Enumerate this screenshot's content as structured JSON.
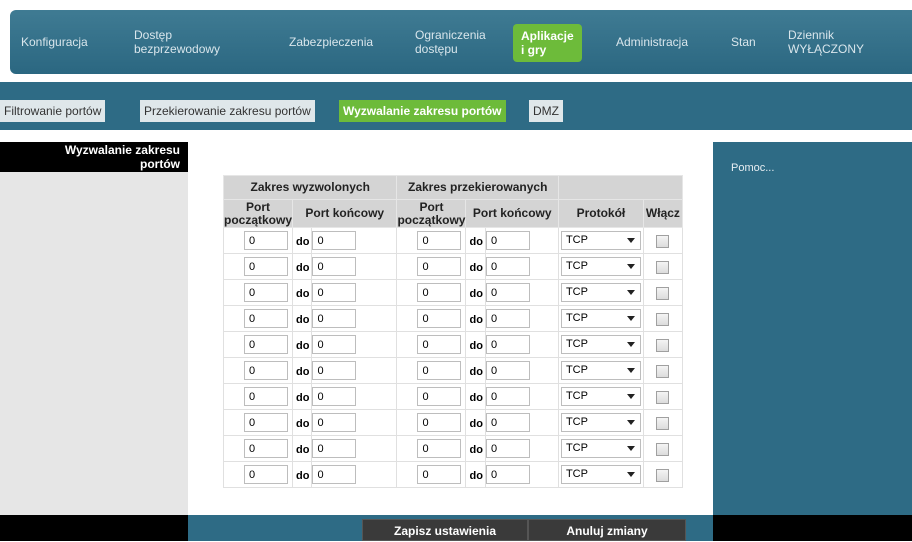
{
  "nav": {
    "items": [
      {
        "label": "Konfiguracja"
      },
      {
        "label1": "Dostęp",
        "label2": "bezprzewodowy"
      },
      {
        "label": "Zabezpieczenia"
      },
      {
        "label1": "Ograniczenia",
        "label2": "dostępu"
      },
      {
        "label1": "Aplikacje",
        "label2": "i gry"
      },
      {
        "label": "Administracja"
      },
      {
        "label": "Stan"
      },
      {
        "label1": "Dziennik",
        "label2": "WYŁĄCZONY"
      }
    ]
  },
  "subnav": {
    "tabs": [
      {
        "label": "Filtrowanie portów"
      },
      {
        "label": "Przekierowanie zakresu portów"
      },
      {
        "label": "Wyzwalanie zakresu portów"
      },
      {
        "label": "DMZ"
      }
    ]
  },
  "section": {
    "title1": "Wyzwalanie zakresu",
    "title2": "portów"
  },
  "table": {
    "group_triggered": "Zakres wyzwolonych",
    "group_forwarded": "Zakres przekierowanych",
    "col_start1": "Port",
    "col_start2": "początkowy",
    "col_end": "Port końcowy",
    "col_protocol": "Protokół",
    "col_enable": "Włącz",
    "sep": "do",
    "rows": [
      {
        "t_start": "0",
        "t_end": "0",
        "f_start": "0",
        "f_end": "0",
        "protocol": "TCP",
        "enabled": false
      },
      {
        "t_start": "0",
        "t_end": "0",
        "f_start": "0",
        "f_end": "0",
        "protocol": "TCP",
        "enabled": false
      },
      {
        "t_start": "0",
        "t_end": "0",
        "f_start": "0",
        "f_end": "0",
        "protocol": "TCP",
        "enabled": false
      },
      {
        "t_start": "0",
        "t_end": "0",
        "f_start": "0",
        "f_end": "0",
        "protocol": "TCP",
        "enabled": false
      },
      {
        "t_start": "0",
        "t_end": "0",
        "f_start": "0",
        "f_end": "0",
        "protocol": "TCP",
        "enabled": false
      },
      {
        "t_start": "0",
        "t_end": "0",
        "f_start": "0",
        "f_end": "0",
        "protocol": "TCP",
        "enabled": false
      },
      {
        "t_start": "0",
        "t_end": "0",
        "f_start": "0",
        "f_end": "0",
        "protocol": "TCP",
        "enabled": false
      },
      {
        "t_start": "0",
        "t_end": "0",
        "f_start": "0",
        "f_end": "0",
        "protocol": "TCP",
        "enabled": false
      },
      {
        "t_start": "0",
        "t_end": "0",
        "f_start": "0",
        "f_end": "0",
        "protocol": "TCP",
        "enabled": false
      },
      {
        "t_start": "0",
        "t_end": "0",
        "f_start": "0",
        "f_end": "0",
        "protocol": "TCP",
        "enabled": false
      }
    ]
  },
  "help": {
    "label": "Pomoc..."
  },
  "footer": {
    "save_label": "Zapisz ustawienia",
    "cancel_label": "Anuluj zmiany"
  },
  "colors": {
    "accent": "#6dbb3a",
    "bar": "#2e6b85"
  }
}
